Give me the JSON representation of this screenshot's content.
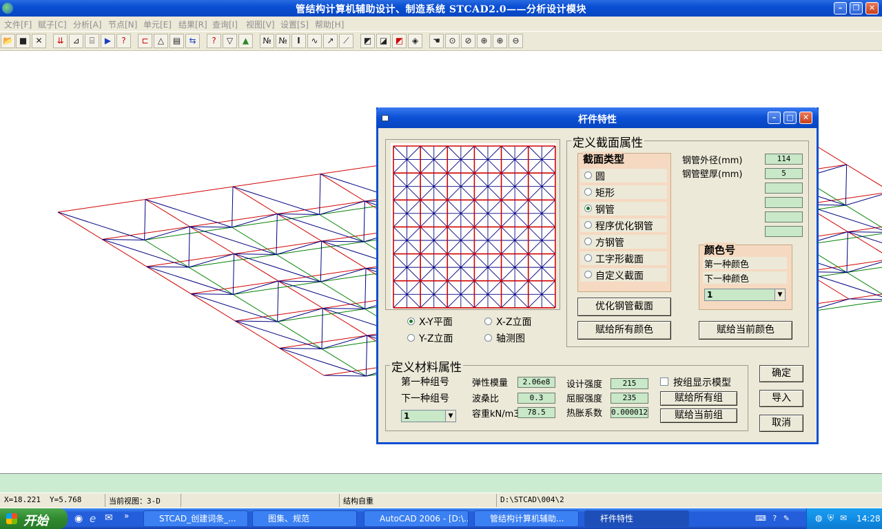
{
  "window": {
    "title": "管结构计算机辅助设计、制造系统 STCAD2.0——分析设计模块"
  },
  "menu": [
    {
      "label": "文件[F]"
    },
    {
      "label": "赋子[C]"
    },
    {
      "label": "分析[A]"
    },
    {
      "label": "节点[N]"
    },
    {
      "label": "单元[E]"
    },
    {
      "label": "结果[R]"
    },
    {
      "label": "查询[I]"
    },
    {
      "label": "视图[V]"
    },
    {
      "label": "设置[S]"
    },
    {
      "label": "帮助[H]"
    }
  ],
  "dialog": {
    "title": "杆件特性",
    "section_group_label": "定义截面属性",
    "section_type_label": "截面类型",
    "section_types": [
      "圆",
      "矩形",
      "钢管",
      "程序优化钢管",
      "方钢管",
      "工字形截面",
      "自定义截面"
    ],
    "selected_section_type": "钢管",
    "pipe_outer_label": "钢管外径(mm)",
    "pipe_outer_value": "114",
    "pipe_wall_label": "钢管壁厚(mm)",
    "pipe_wall_value": "5",
    "color_group_label": "颜色号",
    "first_color_label": "第一种颜色",
    "next_color_label": "下一种颜色",
    "color_value": "1",
    "optimize_button": "优化钢管截面",
    "assign_all_colors_button": "赋给所有颜色",
    "assign_current_color_button": "赋给当前颜色",
    "view_options": [
      "X-Y平面",
      "X-Z立面",
      "Y-Z立面",
      "轴测图"
    ],
    "selected_view": "X-Y平面",
    "material_group_label": "定义材料属性",
    "first_group_label": "第一种组号",
    "next_group_label": "下一种组号",
    "group_value": "1",
    "elastic_label": "弹性模量",
    "elastic_value": "2.06e8",
    "poisson_label": "波桑比",
    "poisson_value": "0.3",
    "density_label": "容重kN/m3",
    "density_value": "78.5",
    "design_strength_label": "设计强度",
    "design_strength_value": "215",
    "yield_strength_label": "屈服强度",
    "yield_strength_value": "235",
    "thermal_label": "热胀系数",
    "thermal_value": "0.000012",
    "show_by_group_label": "按组显示模型",
    "assign_all_groups_button": "赋给所有组",
    "assign_current_group_button": "赋给当前组",
    "ok_button": "确定",
    "import_button": "导入",
    "cancel_button": "取消"
  },
  "status": {
    "x": "X=18.221",
    "y": "Y=5.768",
    "view": "当前视图：3-D",
    "load": "结构自重",
    "path": "D:\\STCAD\\004\\2"
  },
  "taskbar": {
    "start_label": "开始",
    "tasks": [
      {
        "label": "STCAD_创建词条_..."
      },
      {
        "label": "图集、规范"
      },
      {
        "label": "AutoCAD 2006 - [D:\\..."
      },
      {
        "label": "管结构计算机辅助..."
      },
      {
        "label": "杆件特性"
      }
    ],
    "clock": "14:28"
  },
  "colors": {
    "grid_red": "#d00000",
    "grid_blue": "#000080",
    "grid_green": "#008000",
    "field_bg": "#c8e8c8",
    "dialog_bg": "#ece9d8",
    "title_blue": "#0a4fd4"
  }
}
